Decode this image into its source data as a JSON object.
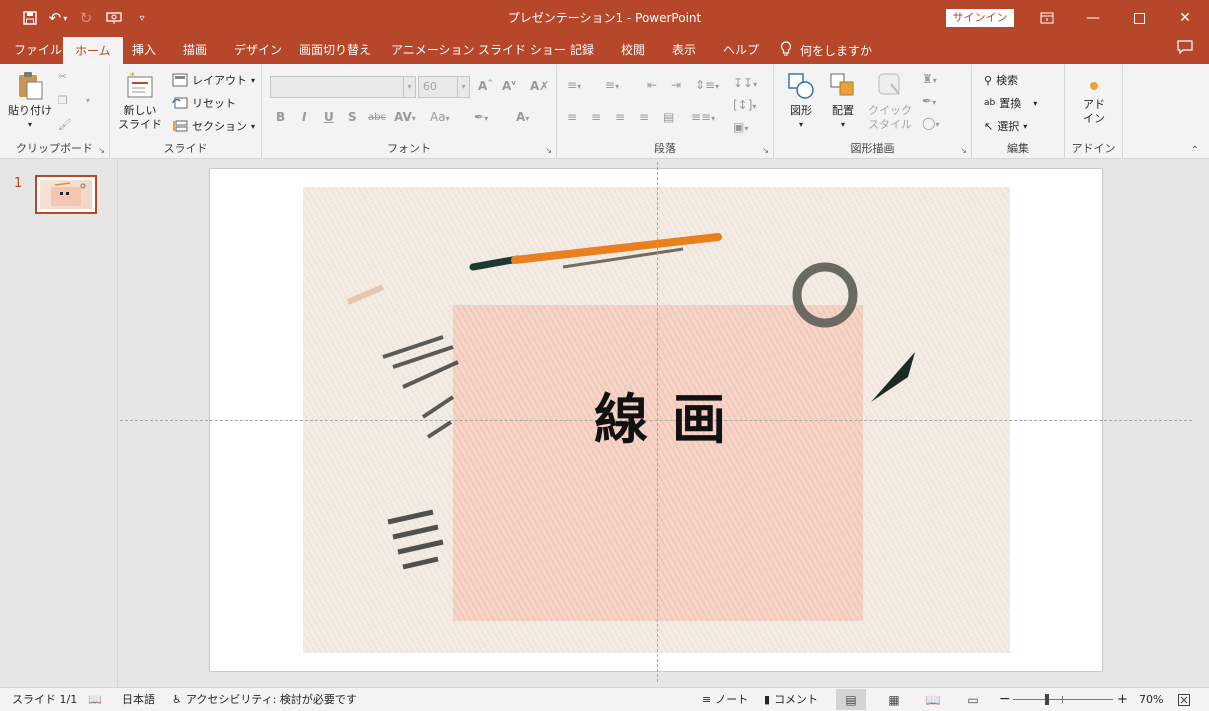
{
  "titlebar": {
    "title": "プレゼンテーション1  -  PowerPoint",
    "signin": "サインイン",
    "qa_icons": [
      "save-icon",
      "undo-icon",
      "redo-icon",
      "present-icon",
      "customize-icon"
    ]
  },
  "tabs": [
    {
      "label": "ファイル"
    },
    {
      "label": "ホーム"
    },
    {
      "label": "挿入"
    },
    {
      "label": "描画"
    },
    {
      "label": "デザイン"
    },
    {
      "label": "画面切り替え"
    },
    {
      "label": "アニメーション"
    },
    {
      "label": "スライド ショー"
    },
    {
      "label": "記録"
    },
    {
      "label": "校閲"
    },
    {
      "label": "表示"
    },
    {
      "label": "ヘルプ"
    }
  ],
  "tell_me": "何をしますか",
  "ribbon": {
    "clipboard": {
      "label": "クリップボード",
      "paste": "貼り付け"
    },
    "slides": {
      "label": "スライド",
      "new_slide_1": "新しい",
      "new_slide_2": "スライド",
      "layout": "レイアウト",
      "reset": "リセット",
      "section": "セクション"
    },
    "font": {
      "label": "フォント",
      "size": "60"
    },
    "paragraph": {
      "label": "段落"
    },
    "drawing": {
      "label": "図形描画",
      "shapes": "図形",
      "arrange": "配置",
      "quick_styles_1": "クイック",
      "quick_styles_2": "スタイル"
    },
    "editing": {
      "label": "編集",
      "find": "検索",
      "replace": "置換",
      "select": "選択"
    },
    "addins": {
      "label": "アドイン",
      "btn_1": "アド",
      "btn_2": "イン"
    }
  },
  "thumbnail": {
    "number": "1"
  },
  "slide": {
    "title": "線画"
  },
  "status": {
    "slide_count": "スライド 1/1",
    "language": "日本語",
    "accessibility": "アクセシビリティ: 検討が必要です",
    "notes": "ノート",
    "comments": "コメント",
    "zoom": "70%"
  },
  "colors": {
    "accent": "#b7472a",
    "ribbon_bg": "#f3f3f3",
    "canvas_bg": "#e6e6e6"
  }
}
